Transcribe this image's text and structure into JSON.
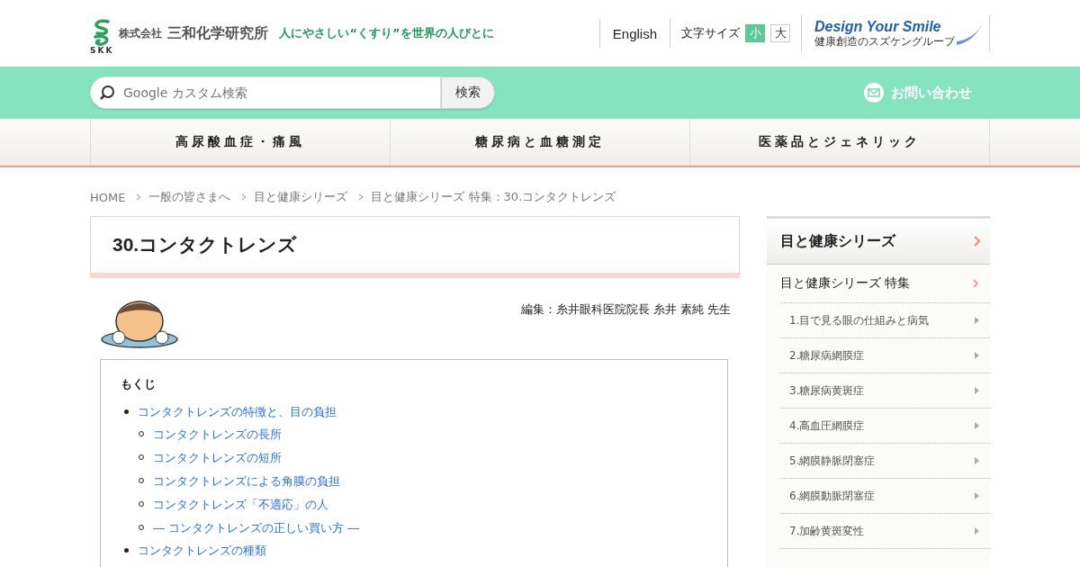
{
  "header": {
    "logo_mark": "SKK",
    "company": "株式会社",
    "company_name": "三和化学研究所",
    "tagline": "人にやさしい“くすり”を世界の人びとに",
    "english_link": "English",
    "font_size": {
      "label": "文字サイズ",
      "options": [
        {
          "label": "小",
          "selected": true
        },
        {
          "label": "大",
          "selected": false
        }
      ]
    },
    "partner": {
      "title": "Design Your Smile",
      "subtitle": "健康創造のスズケングループ"
    }
  },
  "search": {
    "placeholder": "Google カスタム検索",
    "button": "検索",
    "contact": "お問い合わせ"
  },
  "nav": [
    "高尿酸血症・痛風",
    "糖尿病と血糖測定",
    "医薬品とジェネリック"
  ],
  "breadcrumb": [
    "HOME",
    "一般の皆さまへ",
    "目と健康シリーズ",
    "目と健康シリーズ 特集：30.コンタクトレンズ"
  ],
  "article": {
    "title": "30.コンタクトレンズ",
    "editor": "編集：糸井眼科医院院長 糸井 素純 先生",
    "toc": {
      "title": "もくじ",
      "items": [
        {
          "label": "コンタクトレンズの特徴と、目の負担",
          "children": [
            {
              "label": "コンタクトレンズの長所"
            },
            {
              "label": "コンタクトレンズの短所"
            },
            {
              "label": "コンタクトレンズによる角膜の負担"
            },
            {
              "label": "コンタクトレンズ「不適応」の人"
            },
            {
              "label": "― コンタクトレンズの正しい買い方 ―"
            }
          ]
        },
        {
          "label": "コンタクトレンズの種類"
        }
      ]
    }
  },
  "sidebar": {
    "heading": "目と健康シリーズ",
    "section": "目と健康シリーズ 特集",
    "items": [
      "1.目で見る眼の仕組みと病気",
      "2.糖尿病網膜症",
      "3.糖尿病黄斑症",
      "4.高血圧網膜症",
      "5.網膜静脈閉塞症",
      "6.網膜動脈閉塞症",
      "7.加齢黄斑変性"
    ]
  }
}
